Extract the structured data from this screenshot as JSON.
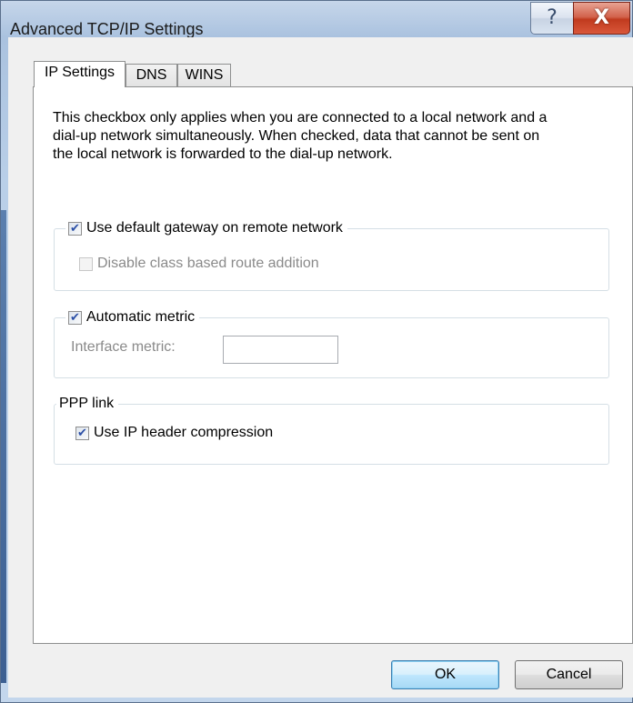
{
  "window": {
    "title": "Advanced TCP/IP Settings",
    "help_glyph": "?",
    "close_glyph": "X"
  },
  "tabs": [
    {
      "label": "IP Settings",
      "active": true
    },
    {
      "label": "DNS",
      "active": false
    },
    {
      "label": "WINS",
      "active": false
    }
  ],
  "description": "This checkbox only applies when you are connected to a local network and a dial-up network simultaneously.  When checked, data that cannot be sent on the local network is forwarded to the dial-up network.",
  "gateway_group": {
    "use_default_gateway_label": "Use default gateway on remote network",
    "use_default_gateway_checked": true,
    "disable_class_route_label": "Disable class based route addition",
    "disable_class_route_checked": false,
    "disable_class_route_enabled": false
  },
  "metric_group": {
    "automatic_metric_label": "Automatic metric",
    "automatic_metric_checked": true,
    "interface_metric_label": "Interface metric:",
    "interface_metric_value": ""
  },
  "ppp_group": {
    "legend": "PPP link",
    "header_compression_label": "Use IP header compression",
    "header_compression_checked": true
  },
  "buttons": {
    "ok": "OK",
    "cancel": "Cancel"
  }
}
